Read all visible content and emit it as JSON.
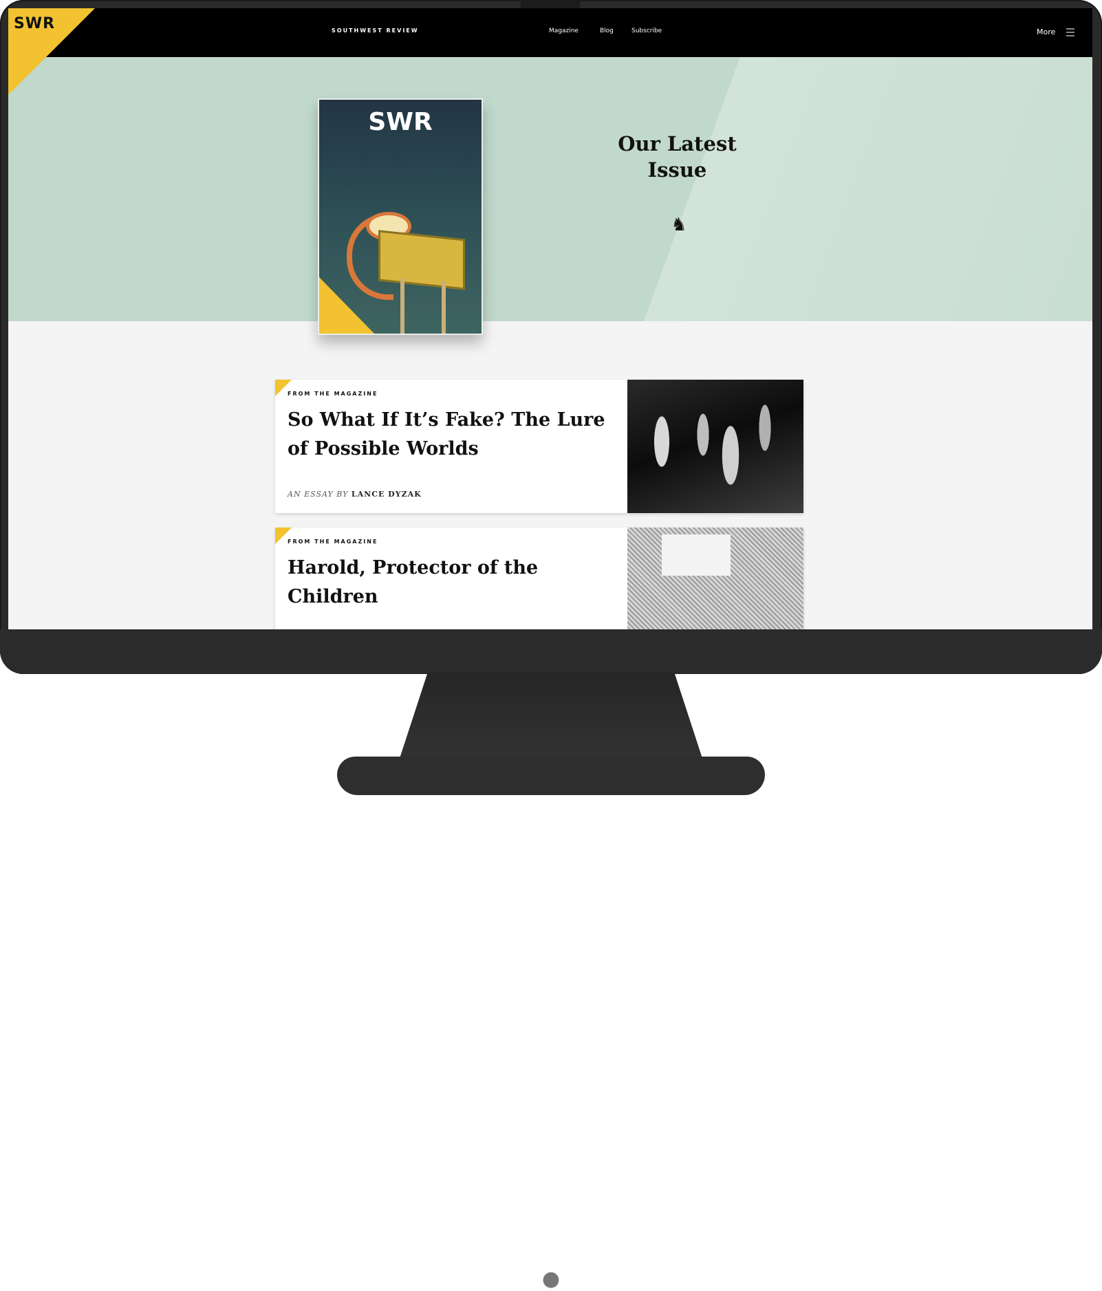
{
  "site": {
    "logo": "SWR",
    "name": "SOUTHWEST REVIEW",
    "nav": [
      "Magazine",
      "Blog",
      "Subscribe"
    ],
    "more_label": "More"
  },
  "hero": {
    "cover_logo": "SWR",
    "heading_line1": "Our Latest",
    "heading_line2": "Issue"
  },
  "articles": [
    {
      "label": "FROM THE MAGAZINE",
      "title": "So What If It’s Fake? The Lure of Possible Worlds",
      "byline_kind": "AN ESSAY BY",
      "author": "LANCE DYZAK"
    },
    {
      "label": "FROM THE MAGAZINE",
      "title": "Harold, Protector of the Children"
    }
  ],
  "colors": {
    "accent": "#f2c230",
    "hero_bg": "#c1d9cc",
    "topbar": "#000000",
    "monitor": "#2a2a2a"
  },
  "icons": [
    "menu-icon",
    "horse-icon",
    "apple-logo-icon"
  ]
}
